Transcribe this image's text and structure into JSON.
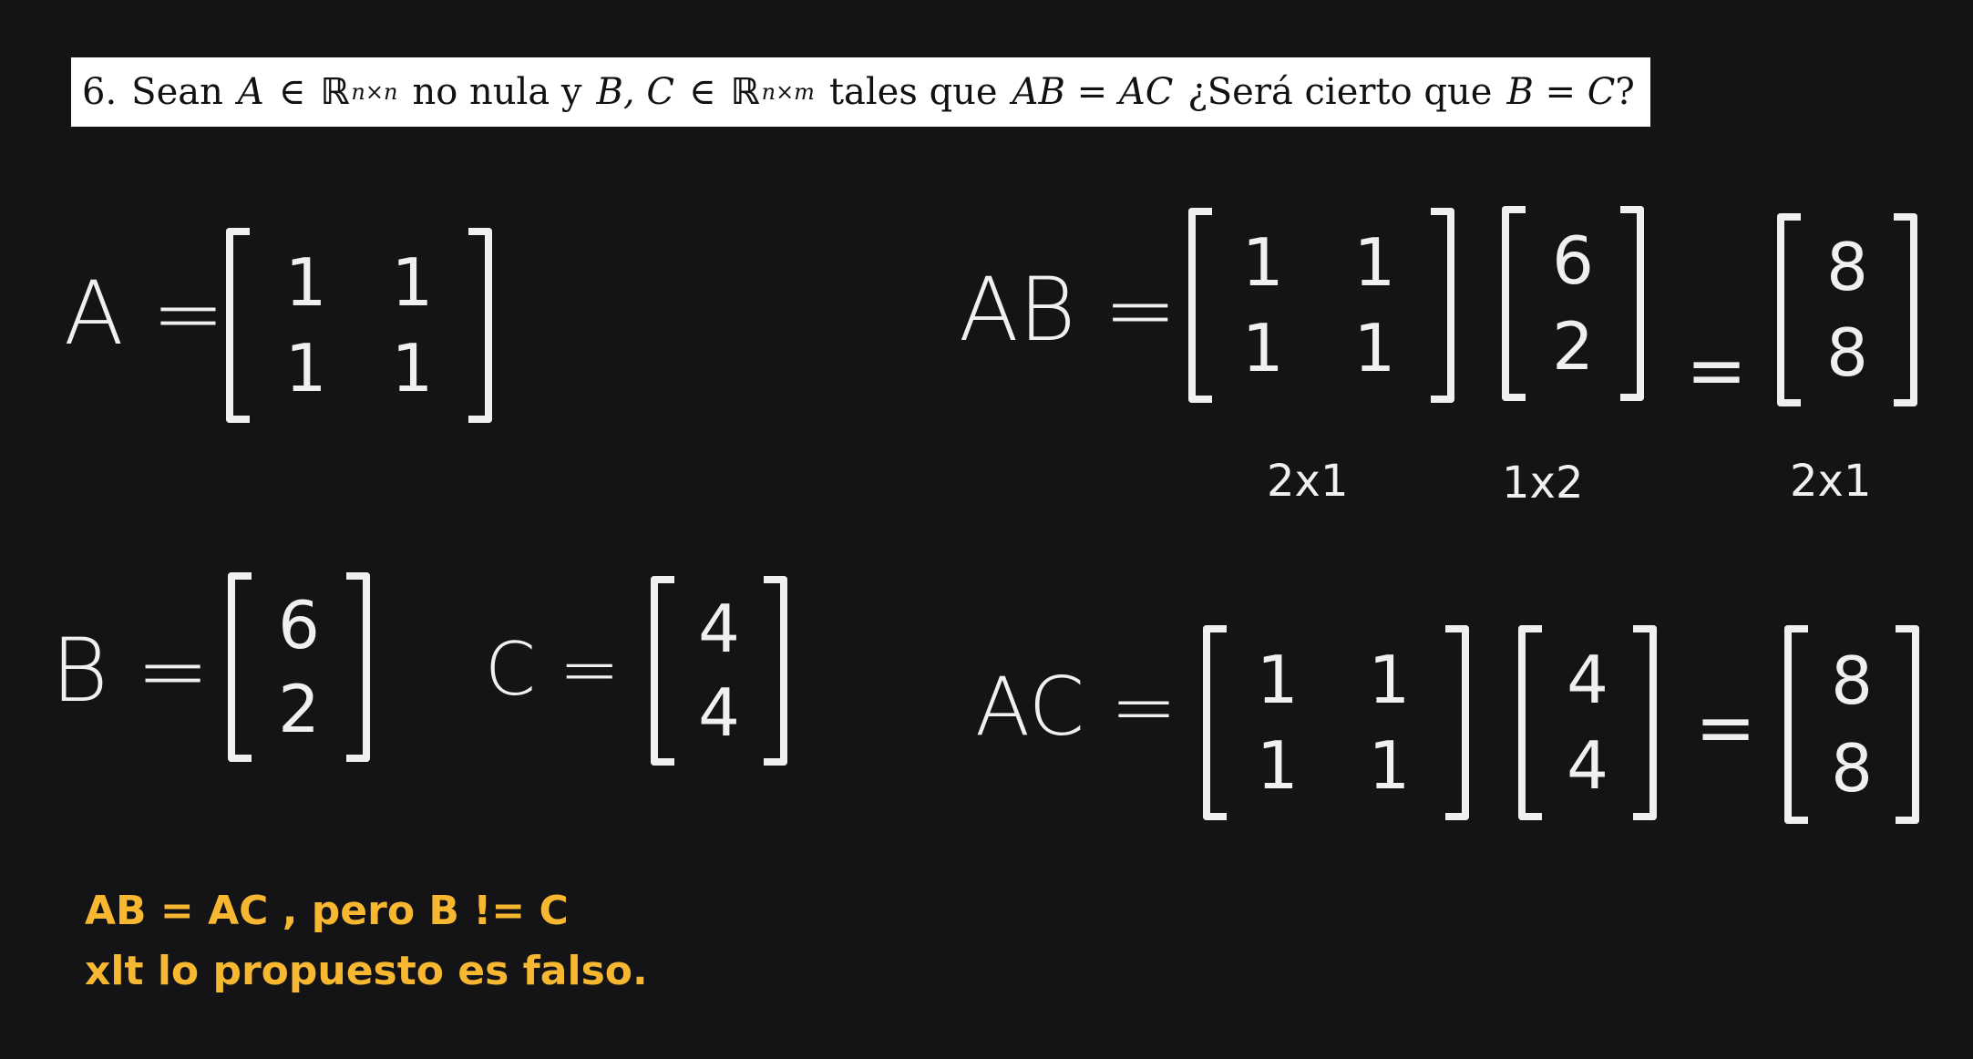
{
  "problem": {
    "number": "6.",
    "t1": "Sean",
    "A": "A",
    "in1": "∈",
    "R1": "ℝ",
    "exp1": "n×n",
    "t2": "no nula y",
    "BC": "B, C",
    "in2": "∈",
    "R2": "ℝ",
    "exp2": "n×m",
    "t3": "tales que",
    "eq1": "AB = AC",
    "t4": "¿Será cierto que",
    "eq2": "B = C",
    "q": "?"
  },
  "defs": {
    "A_label": "A =",
    "A_matrix": [
      [
        "1",
        "1"
      ],
      [
        "1",
        "1"
      ]
    ],
    "B_label": "B =",
    "B_matrix": [
      "6",
      "2"
    ],
    "C_label": "C =",
    "C_matrix": [
      "4",
      "4"
    ]
  },
  "product_AB": {
    "label": "AB =",
    "left": [
      [
        "1",
        "1"
      ],
      [
        "1",
        "1"
      ]
    ],
    "right": [
      "6",
      "2"
    ],
    "equals": "=",
    "result": [
      "8",
      "8"
    ],
    "dims": [
      "2x1",
      "1x2",
      "2x1"
    ]
  },
  "product_AC": {
    "label": "AC =",
    "left": [
      [
        "1",
        "1"
      ],
      [
        "1",
        "1"
      ]
    ],
    "right": [
      "4",
      "4"
    ],
    "equals": "=",
    "result": [
      "8",
      "8"
    ]
  },
  "conclusion": {
    "line1": "AB = AC , pero B != C",
    "line2": "xlt lo propuesto es falso."
  },
  "colors": {
    "background": "#141416",
    "chalk": "#f0f0f0",
    "highlight": "#f7b731",
    "banner": "#ffffff"
  }
}
